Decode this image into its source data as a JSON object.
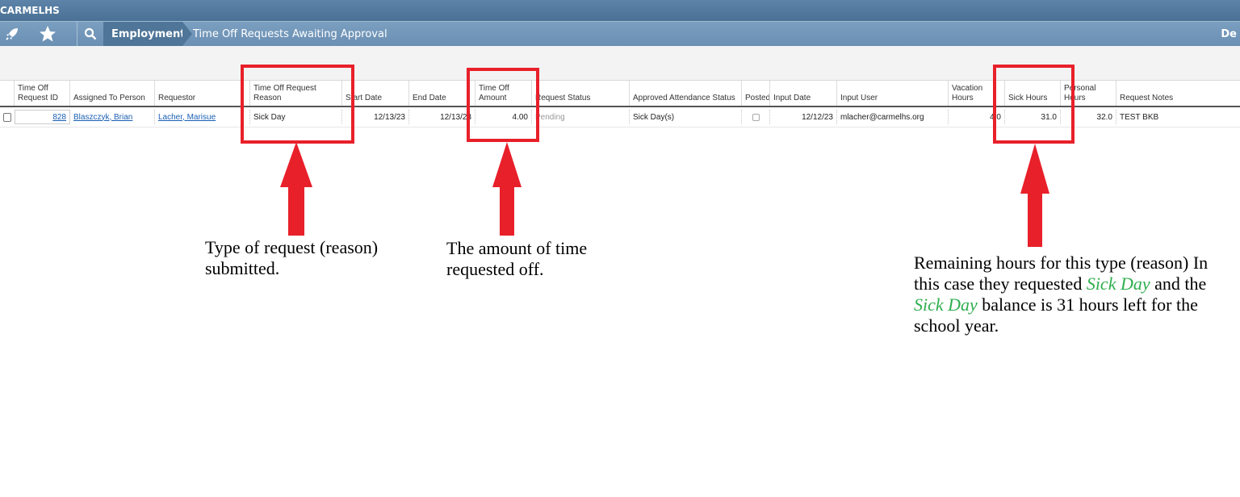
{
  "app": {
    "org_name": "CARMELHS",
    "user_initial": "De"
  },
  "nav": {
    "breadcrumb_module": "Employment",
    "page_title": "Time Off Requests Awaiting Approval"
  },
  "icons": {
    "launch": "rocket-icon",
    "favorites": "star-icon",
    "search": "search-icon"
  },
  "table": {
    "headers": {
      "id": "Time Off Request ID",
      "assigned": "Assigned To Person",
      "requestor": "Requestor",
      "reason": "Time Off Request Reason",
      "start": "Start Date",
      "end": "End Date",
      "amount": "Time Off Amount",
      "status": "Request Status",
      "attendance": "Approved Attendance Status",
      "posted": "Posted",
      "input_date": "Input Date",
      "input_user": "Input User",
      "vacation": "Vacation Hours",
      "sick": "Sick Hours",
      "personal": "Personal Hours",
      "notes": "Request Notes"
    },
    "row": {
      "id": "828",
      "assigned": "Blaszczyk, Brian",
      "requestor": "Lacher, Marisue",
      "reason": "Sick Day",
      "start": "12/13/23",
      "end": "12/13/23",
      "amount": "4.00",
      "status": "Pending",
      "attendance": "Sick Day(s)",
      "input_date": "12/12/23",
      "input_user": "mlacher@carmelhs.org",
      "vacation": "4.0",
      "sick": "31.0",
      "personal": "32.0",
      "notes": "TEST BKB"
    }
  },
  "annotations": {
    "accent_color": "#e8202a",
    "highlight_color": "#2fae4e",
    "reason_note": "Type of request (reason) submitted.",
    "amount_note": "The amount of time requested off.",
    "sick_note_a": "Remaining hours for this type (reason) In this case they requested ",
    "sick_note_hl1": "Sick Day",
    "sick_note_b": " and the ",
    "sick_note_hl2": "Sick Day",
    "sick_note_c": " balance is 31 hours left for the school year."
  }
}
